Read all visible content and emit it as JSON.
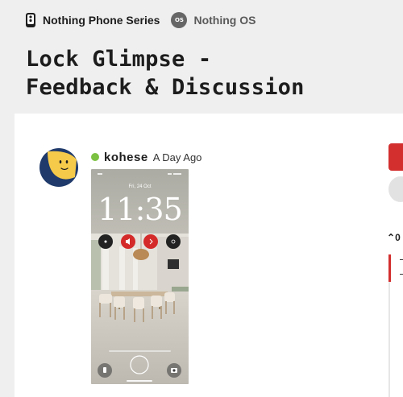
{
  "breadcrumb": {
    "category_label": "Nothing Phone Series",
    "subcategory_label": "Nothing OS",
    "subcategory_icon_text": "OS"
  },
  "topic": {
    "title_line1": "Lock Glimpse -",
    "title_line2": "Feedback & Discussion"
  },
  "post": {
    "username": "kohese",
    "time_ago": "A Day Ago",
    "online": true,
    "screenshot": {
      "date": "Fri, 24 Oct",
      "time": "11:35"
    }
  },
  "sidebar": {
    "progress_label": "0"
  },
  "colors": {
    "accent_red": "#d32f2f",
    "online_green": "#7cc142",
    "avatar_bg": "#1f3a6b",
    "avatar_face": "#f5c94a"
  }
}
